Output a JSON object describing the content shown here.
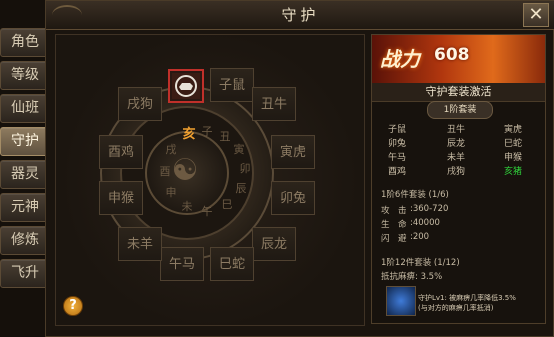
{
  "window": {
    "title": "守护",
    "close_label": "✕"
  },
  "tabs": [
    {
      "label": "角色",
      "active": false
    },
    {
      "label": "等级",
      "active": false
    },
    {
      "label": "仙班",
      "active": false
    },
    {
      "label": "守护",
      "active": true
    },
    {
      "label": "器灵",
      "active": false
    },
    {
      "label": "元神",
      "active": false
    },
    {
      "label": "修炼",
      "active": false
    },
    {
      "label": "飞升",
      "active": false
    }
  ],
  "board": {
    "slots": [
      "子鼠",
      "丑牛",
      "寅虎",
      "卯兔",
      "辰龙",
      "巳蛇",
      "午马",
      "未羊",
      "申猴",
      "酉鸡",
      "戌狗"
    ],
    "highlight_char": "亥",
    "ring_chars": [
      "子",
      "丑",
      "寅",
      "卯",
      "辰",
      "巳",
      "午",
      "未",
      "申",
      "酉",
      "戌"
    ],
    "help_label": "?"
  },
  "panel": {
    "power_label": "战力",
    "power_value": "608",
    "section_title": "守护套装激活",
    "tier1_label": "1阶套装",
    "zodiac_grid": [
      {
        "name": "子鼠",
        "active": false
      },
      {
        "name": "丑牛",
        "active": false
      },
      {
        "name": "寅虎",
        "active": false
      },
      {
        "name": "卯兔",
        "active": false
      },
      {
        "name": "辰龙",
        "active": false
      },
      {
        "name": "巳蛇",
        "active": false
      },
      {
        "name": "午马",
        "active": false
      },
      {
        "name": "未羊",
        "active": false
      },
      {
        "name": "申猴",
        "active": false
      },
      {
        "name": "酉鸡",
        "active": false
      },
      {
        "name": "戌狗",
        "active": false
      },
      {
        "name": "亥猪",
        "active": true
      }
    ],
    "set6_title": "1阶6件套装 (1/6)",
    "stats": [
      {
        "label": "攻　击",
        "value": ":360-720"
      },
      {
        "label": "生　命",
        "value": ":40000"
      },
      {
        "label": "闪　避",
        "value": ":200"
      }
    ],
    "set12_title": "1阶12件套装 (1/12)",
    "set12_bonus": "抵抗麻痹: 3.5%",
    "skill_line1": "守护Lv1: 被麻痹几率降低3.5%",
    "skill_line2": "(与对方的麻痹几率抵消)"
  }
}
